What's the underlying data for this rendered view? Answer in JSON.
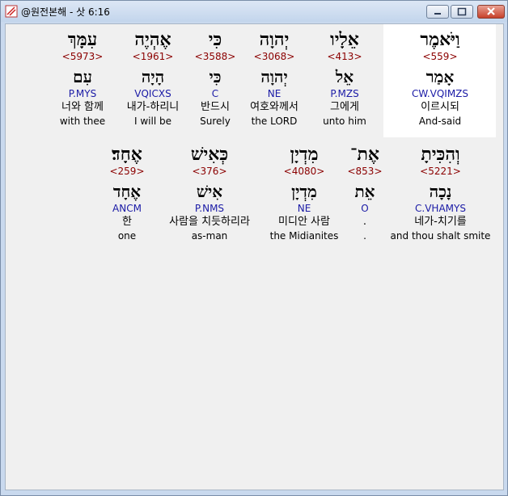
{
  "window": {
    "title": "@원전본해 - 삿 6:16"
  },
  "row1": [
    {
      "heb": "עִמָּךְ",
      "strong": "<5973>",
      "root": "עִם",
      "parse": "P.MYS",
      "kor": "너와 함께",
      "eng": "with thee"
    },
    {
      "heb": "אֶהְיֶה",
      "strong": "<1961>",
      "root": "הָיָה",
      "parse": "VQICXS",
      "kor": "내가-하리니",
      "eng": "I will be"
    },
    {
      "heb": "כִּי",
      "strong": "<3588>",
      "root": "כִּי",
      "parse": "C",
      "kor": "반드시",
      "eng": "Surely"
    },
    {
      "heb": "יְהוָה",
      "strong": "<3068>",
      "root": "יְהוָה",
      "parse": "NE",
      "kor": "여호와께서",
      "eng": "the LORD"
    },
    {
      "heb": "אֵלָיו",
      "strong": "<413>",
      "root": "אֵל",
      "parse": "P.MZS",
      "kor": "그에게",
      "eng": "unto him"
    },
    {
      "heb": "וַיֹּאמֶר",
      "strong": "<559>",
      "root": "אָמַר",
      "parse": "CW.VQIMZS",
      "kor": "이르시되",
      "eng": "And-said"
    }
  ],
  "row2": [
    {
      "heb": "אֶחָד׃",
      "strong": "<259>",
      "root": "אֶחָד",
      "parse": "ANCM",
      "kor": "한",
      "eng": "one"
    },
    {
      "heb": "כְּאִישׁ",
      "strong": "<376>",
      "root": "אִישׁ",
      "parse": "P.NMS",
      "kor": "사람을 치듯하리라",
      "eng": "as-man"
    },
    {
      "heb": "מִדְיָן",
      "strong": "<4080>",
      "root": "מִדְיָן",
      "parse": "NE",
      "kor": "미디안 사람",
      "eng": "the Midianites"
    },
    {
      "heb": "אֶת־",
      "strong": "<853>",
      "root": "אֵת",
      "parse": "O",
      "kor": ".",
      "eng": "."
    },
    {
      "heb": "וְהִכִּיתָ",
      "strong": "<5221>",
      "root": "נָכָה",
      "parse": "C.VHAMYS",
      "kor": "네가-치기를",
      "eng": "and thou shalt smite"
    }
  ]
}
